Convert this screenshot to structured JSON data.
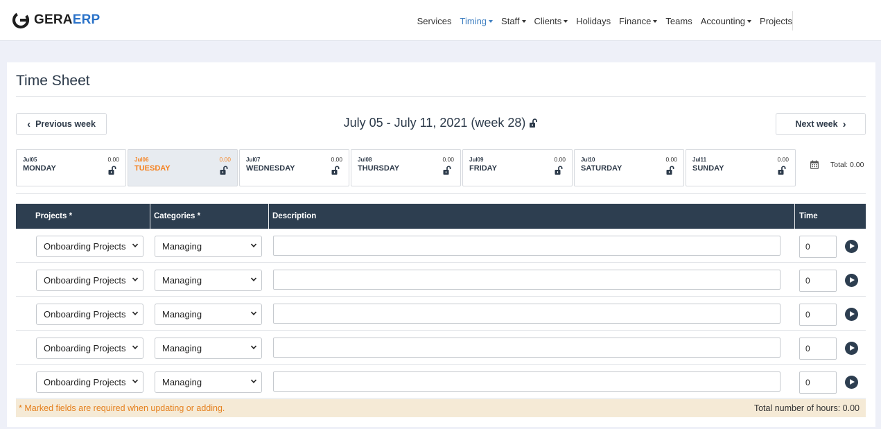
{
  "header": {
    "logo_part1": "GERA",
    "logo_part2": "ERP",
    "nav": [
      {
        "label": "Services",
        "dropdown": false,
        "active": false
      },
      {
        "label": "Timing",
        "dropdown": true,
        "active": true
      },
      {
        "label": "Staff",
        "dropdown": true,
        "active": false
      },
      {
        "label": "Clients",
        "dropdown": true,
        "active": false
      },
      {
        "label": "Holidays",
        "dropdown": false,
        "active": false
      },
      {
        "label": "Finance",
        "dropdown": true,
        "active": false
      },
      {
        "label": "Teams",
        "dropdown": false,
        "active": false
      },
      {
        "label": "Accounting",
        "dropdown": true,
        "active": false
      },
      {
        "label": "Projects",
        "dropdown": false,
        "active": false
      }
    ]
  },
  "page": {
    "title": "Time Sheet",
    "prev_week": "Previous week",
    "next_week": "Next week",
    "week_label": "July 05 - July 11, 2021 (week 28)",
    "total_label": "Total: 0.00"
  },
  "days": [
    {
      "date": "Jul05",
      "name": "MONDAY",
      "hours": "0.00",
      "active": false
    },
    {
      "date": "Jul06",
      "name": "TUESDAY",
      "hours": "0.00",
      "active": true
    },
    {
      "date": "Jul07",
      "name": "WEDNESDAY",
      "hours": "0.00",
      "active": false
    },
    {
      "date": "Jul08",
      "name": "THURSDAY",
      "hours": "0.00",
      "active": false
    },
    {
      "date": "Jul09",
      "name": "FRIDAY",
      "hours": "0.00",
      "active": false
    },
    {
      "date": "Jul10",
      "name": "SATURDAY",
      "hours": "0.00",
      "active": false
    },
    {
      "date": "Jul11",
      "name": "SUNDAY",
      "hours": "0.00",
      "active": false
    }
  ],
  "table": {
    "headers": {
      "projects": "Projects *",
      "categories": "Categories *",
      "description": "Description",
      "time": "Time"
    },
    "rows": [
      {
        "project": "Onboarding Projects",
        "category": "Managing",
        "description": "",
        "time": "0"
      },
      {
        "project": "Onboarding Projects",
        "category": "Managing",
        "description": "",
        "time": "0"
      },
      {
        "project": "Onboarding Projects",
        "category": "Managing",
        "description": "",
        "time": "0"
      },
      {
        "project": "Onboarding Projects",
        "category": "Managing",
        "description": "",
        "time": "0"
      },
      {
        "project": "Onboarding Projects",
        "category": "Managing",
        "description": "",
        "time": "0"
      }
    ]
  },
  "footer": {
    "note": "* Marked fields are required when updating or adding.",
    "total_hours": "Total number of hours: 0.00"
  },
  "colors": {
    "accent": "#2d3e50",
    "active_day": "#f58220",
    "nav_active": "#3f7fc1",
    "footer_bg": "#f5ead6"
  }
}
